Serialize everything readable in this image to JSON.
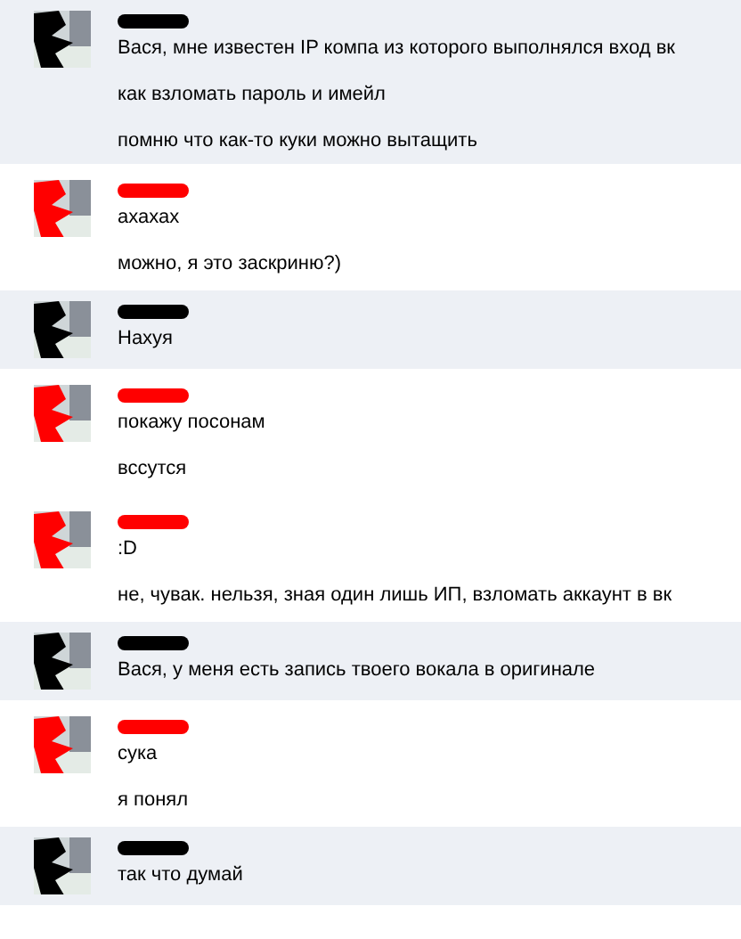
{
  "messages": [
    {
      "highlighted": true,
      "color": "#000000",
      "lines": [
        "Вася, мне известен IP компа из которого выполнялся вход вк",
        "как взломать пароль и имейл",
        "помню что как-то куки можно вытащить"
      ]
    },
    {
      "highlighted": false,
      "color": "#ff0000",
      "lines": [
        "ахахах",
        "можно, я это заскриню?)"
      ]
    },
    {
      "highlighted": true,
      "color": "#000000",
      "lines": [
        "Нахуя"
      ]
    },
    {
      "highlighted": false,
      "color": "#ff0000",
      "lines": [
        "покажу посонам",
        "вссутся"
      ]
    },
    {
      "highlighted": false,
      "color": "#ff0000",
      "lines": [
        ":D",
        "не, чувак. нельзя, зная один лишь ИП, взломать аккаунт в вк"
      ]
    },
    {
      "highlighted": true,
      "color": "#000000",
      "lines": [
        "Вася, у меня есть запись твоего вокала в оригинале"
      ]
    },
    {
      "highlighted": false,
      "color": "#ff0000",
      "lines": [
        "сука",
        "я понял"
      ]
    },
    {
      "highlighted": true,
      "color": "#000000",
      "lines": [
        "так что думай"
      ]
    }
  ]
}
